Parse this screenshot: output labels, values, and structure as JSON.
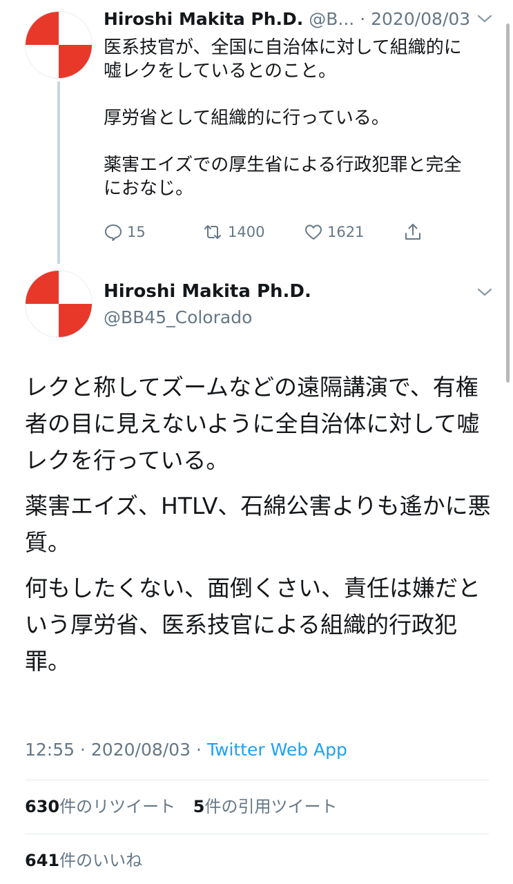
{
  "colors": {
    "avatar_red": "#e8382a",
    "avatar_white": "#ffffff",
    "muted": "#657786",
    "link": "#1da1f2",
    "text": "#14171a"
  },
  "tweet1": {
    "name": "Hiroshi Makita Ph.D.",
    "handle_truncated": "@B...",
    "separator": "·",
    "date": "2020/08/03",
    "body": {
      "line1": "医系技官が、全国に自治体に対して組織的に",
      "line2": "嘘レクをしているとのこと。",
      "line3": "厚労省として組織的に行っている。",
      "line4": "薬害エイズでの厚生省による行政犯罪と完全",
      "line5": "におなじ。"
    },
    "actions": {
      "reply_icon": "reply-icon",
      "reply_count": "15",
      "retweet_icon": "retweet-icon",
      "retweet_count": "1400",
      "like_icon": "heart-icon",
      "like_count": "1621",
      "share_icon": "share-icon"
    }
  },
  "tweet2": {
    "name": "Hiroshi Makita Ph.D.",
    "handle": "@BB45_Colorado",
    "body": {
      "p1": "レクと称してズームなどの遠隔講演で、有権者の目に見えないように全自治体に対して嘘レクを行っている。",
      "p2": "薬害エイズ、HTLV、石綿公害よりも遙かに悪質。",
      "p3": "何もしたくない、面倒くさい、責任は嫌だという厚労省、医系技官による組織的行政犯罪。"
    },
    "meta": {
      "time": "12:55",
      "sep1": "·",
      "date": "2020/08/03",
      "sep2": "·",
      "source": "Twitter Web App"
    },
    "stats": {
      "retweets_num": "630",
      "retweets_label": "件のリツイート",
      "quotes_num": "5",
      "quotes_label": "件の引用ツイート",
      "likes_num": "641",
      "likes_label": "件のいいね"
    }
  }
}
